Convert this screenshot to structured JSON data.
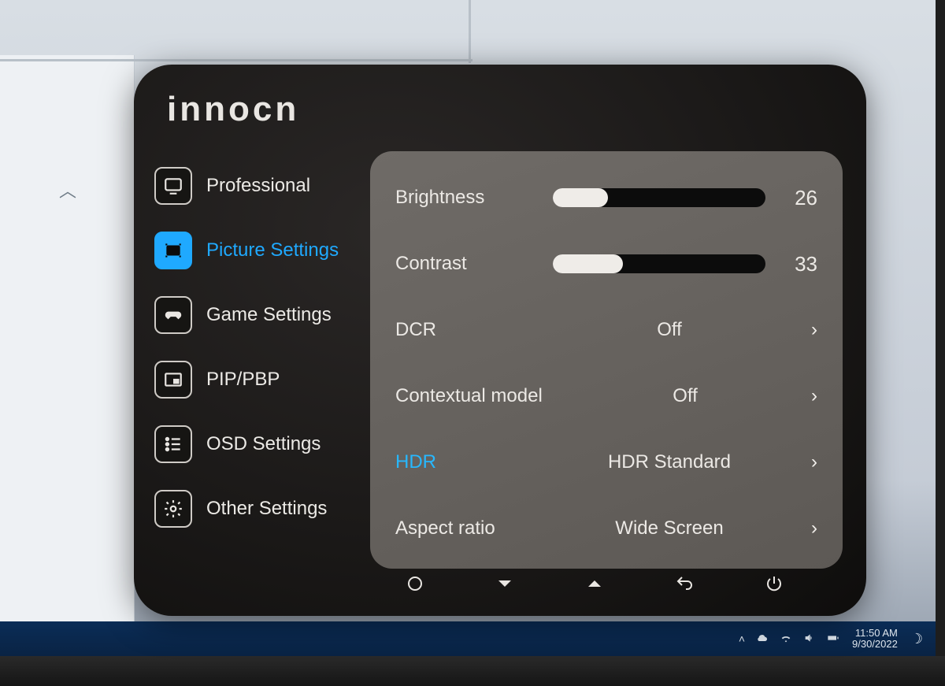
{
  "brand": "innocn",
  "taskbar": {
    "time": "11:50 AM",
    "date": "9/30/2022"
  },
  "nav": {
    "items": [
      {
        "label": "Professional"
      },
      {
        "label": "Picture Settings"
      },
      {
        "label": "Game Settings"
      },
      {
        "label": "PIP/PBP"
      },
      {
        "label": "OSD Settings"
      },
      {
        "label": "Other Settings"
      }
    ],
    "active_index": 1
  },
  "settings": {
    "brightness": {
      "label": "Brightness",
      "value": 26,
      "max": 100
    },
    "contrast": {
      "label": "Contrast",
      "value": 33,
      "max": 100
    },
    "dcr": {
      "label": "DCR",
      "value": "Off"
    },
    "contextual": {
      "label": "Contextual model",
      "value": "Off"
    },
    "hdr": {
      "label": "HDR",
      "value": "HDR Standard",
      "highlight": true
    },
    "aspect": {
      "label": "Aspect ratio",
      "value": "Wide Screen"
    }
  }
}
